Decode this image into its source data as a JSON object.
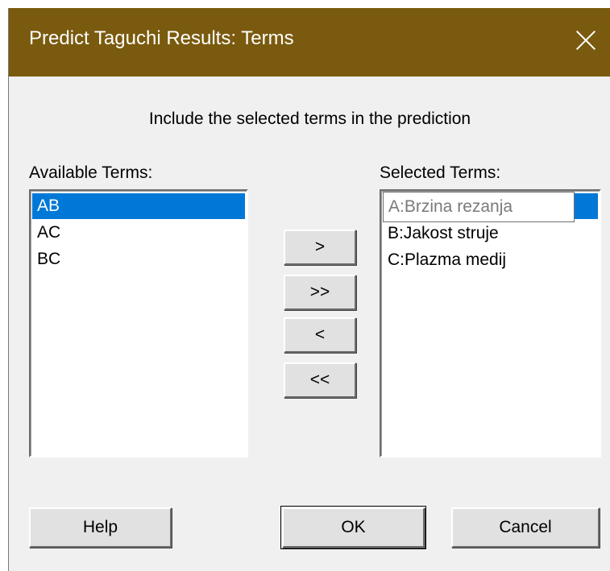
{
  "window": {
    "title": "Predict Taguchi Results: Terms",
    "close_icon": "close-icon"
  },
  "instruction": "Include the selected terms in the prediction",
  "available": {
    "label": "Available Terms:",
    "items": [
      "AB",
      "AC",
      "BC"
    ],
    "selected_item": "AB"
  },
  "selected": {
    "label": "Selected Terms:",
    "editing_value": "A:Brzina rezanja",
    "items": [
      "A:Brzina rezanja",
      "B:Jakost struje",
      "C:Plazma medij"
    ]
  },
  "transfer_buttons": {
    "add_one": ">",
    "add_all": ">>",
    "remove_one": "<",
    "remove_all": "<<"
  },
  "footer": {
    "help": "Help",
    "ok": "OK",
    "cancel": "Cancel"
  },
  "colors": {
    "titlebar": "#7a5a0e",
    "selection": "#0078d7",
    "dialog_bg": "#f0f0f0"
  }
}
